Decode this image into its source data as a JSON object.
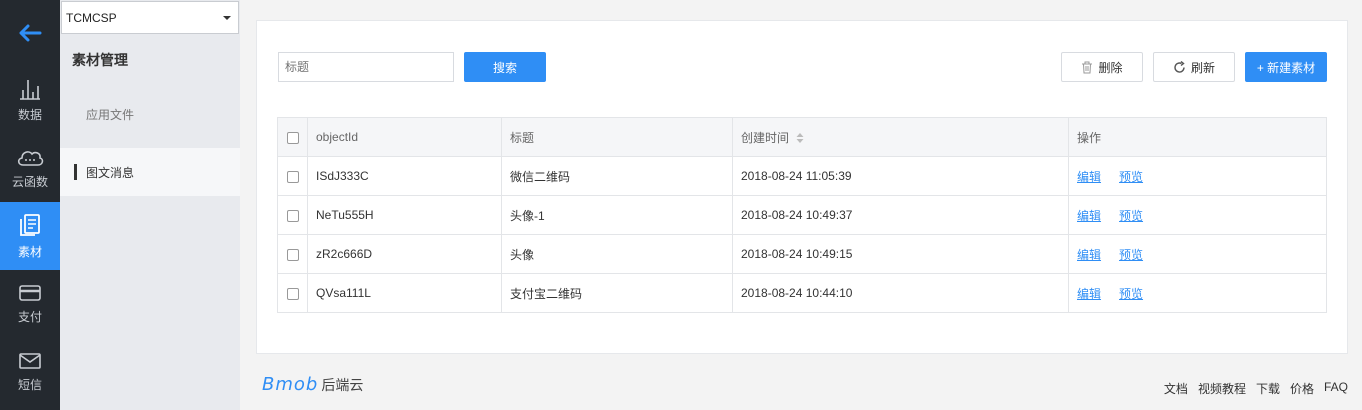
{
  "rail": {
    "items": [
      {
        "label": "数据",
        "icon": "chart-bars-icon"
      },
      {
        "label": "云函数",
        "icon": "cloud-icon"
      },
      {
        "label": "素材",
        "icon": "document-icon"
      },
      {
        "label": "支付",
        "icon": "card-icon"
      },
      {
        "label": "短信",
        "icon": "mail-icon"
      }
    ],
    "active_index": 2,
    "accent": "#2f8ef5"
  },
  "app_selector": {
    "value": "TCMCSP"
  },
  "sidebar": {
    "title": "素材管理",
    "items": [
      {
        "label": "应用文件"
      },
      {
        "label": "图文消息"
      }
    ]
  },
  "toolbar": {
    "search_placeholder": "标题",
    "search_label": "搜索",
    "delete_label": "删除",
    "refresh_label": "刷新",
    "new_label": "+ 新建素材"
  },
  "table": {
    "headers": [
      "objectId",
      "标题",
      "创建时间",
      "操作"
    ],
    "rows": [
      {
        "id": "ISdJ333C",
        "title": "微信二维码",
        "created": "2018-08-24 11:05:39"
      },
      {
        "id": "NeTu555H",
        "title": "头像-1",
        "created": "2018-08-24 10:49:37"
      },
      {
        "id": "zR2c666D",
        "title": "头像",
        "created": "2018-08-24 10:49:15"
      },
      {
        "id": "QVsa111L",
        "title": "支付宝二维码",
        "created": "2018-08-24 10:44:10"
      }
    ],
    "actions": {
      "edit": "编辑",
      "preview": "预览"
    }
  },
  "footer": {
    "logo_text": "Bmob",
    "logo_suffix": "后端云",
    "links": [
      "文档",
      "视频教程",
      "下载",
      "价格",
      "FAQ"
    ]
  }
}
